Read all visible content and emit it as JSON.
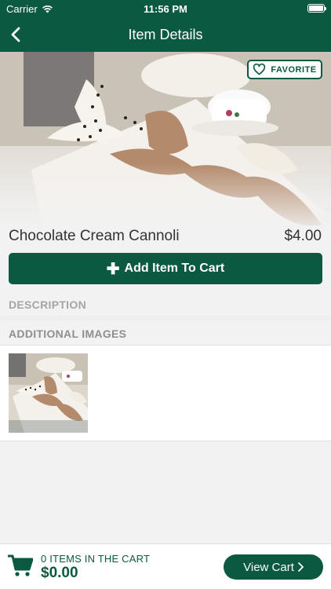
{
  "status_bar": {
    "carrier": "Carrier",
    "time": "11:56 PM"
  },
  "nav": {
    "title": "Item Details",
    "back_icon": "chevron-left-icon"
  },
  "item": {
    "favorite_label": "FAVORITE",
    "name": "Chocolate Cream Cannoli",
    "price": "$4.00",
    "add_to_cart_label": "Add Item To Cart"
  },
  "sections": {
    "description_label": "DESCRIPTION",
    "additional_images_label": "ADDITIONAL IMAGES"
  },
  "footer": {
    "items_count_text": "0 ITEMS IN THE CART",
    "total": "$0.00",
    "view_cart_label": "View Cart"
  },
  "colors": {
    "brand_green": "#0b5940",
    "background": "#f2f2f2"
  }
}
